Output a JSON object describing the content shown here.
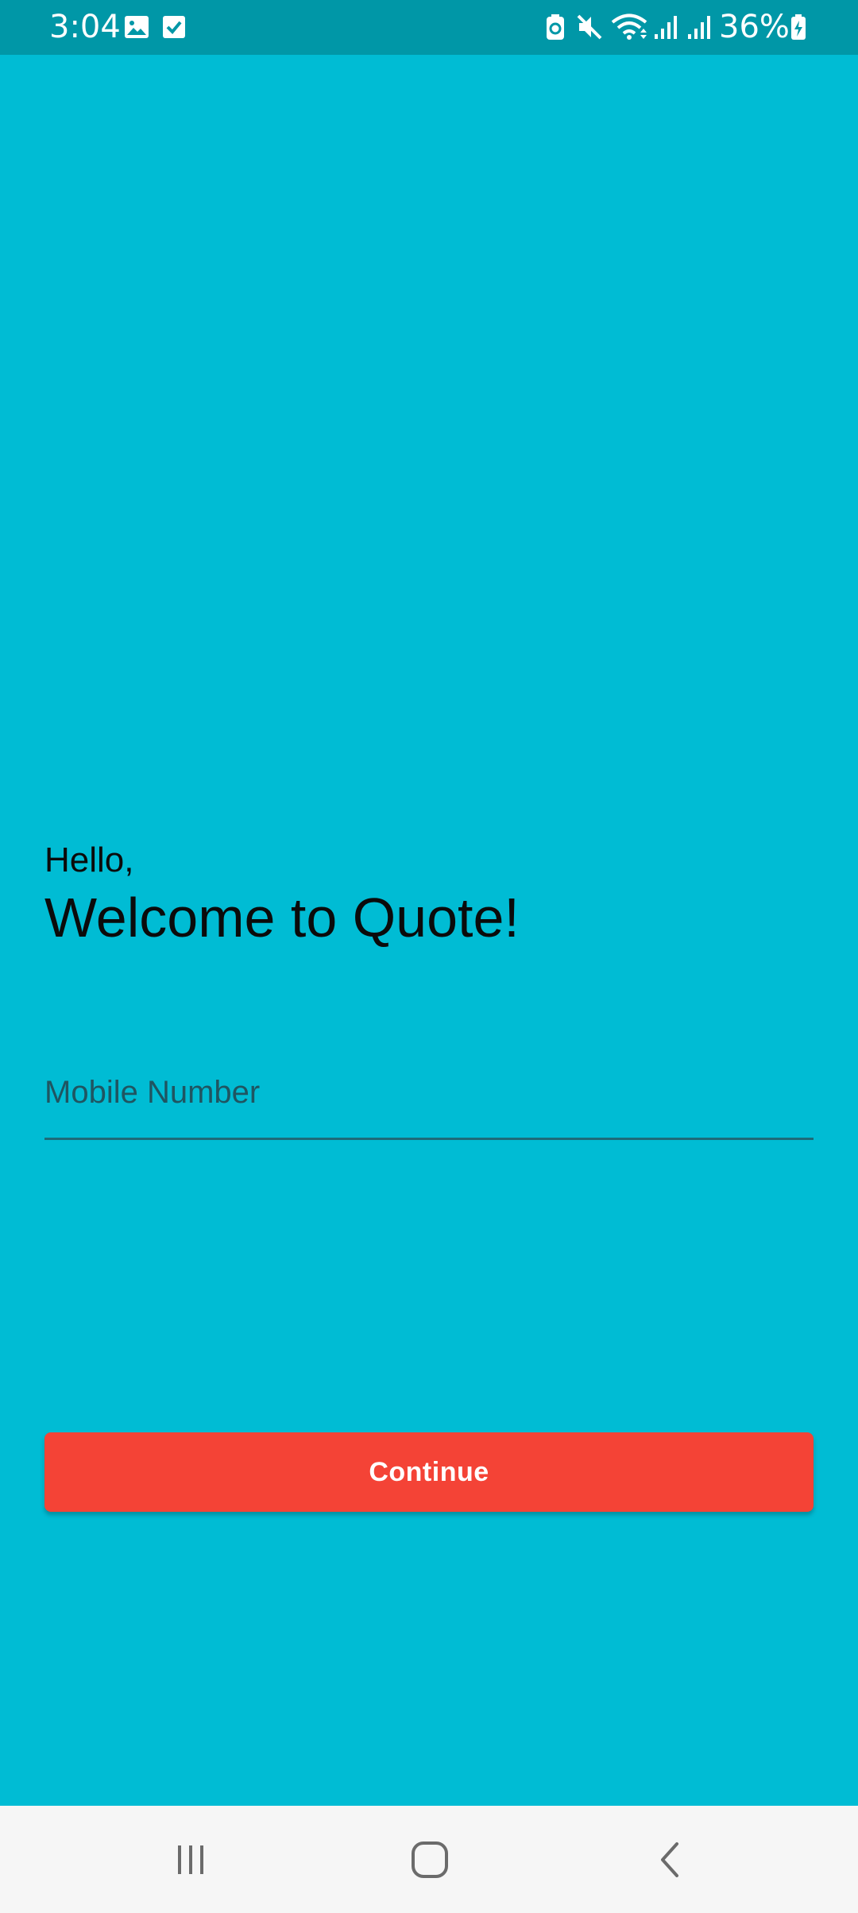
{
  "status_bar": {
    "time": "3:04",
    "battery_percent": "36%",
    "icons": [
      "gallery-icon",
      "checkbox-icon",
      "battery-saver-icon",
      "mute-icon",
      "wifi-icon",
      "signal-icon",
      "signal-icon",
      "battery-charging-icon"
    ]
  },
  "welcome": {
    "greeting": "Hello,",
    "headline": "Welcome to Quote!"
  },
  "form": {
    "mobile_placeholder": "Mobile Number",
    "mobile_value": ""
  },
  "actions": {
    "continue_label": "Continue"
  },
  "navigation": {
    "icons": [
      "recent-apps-icon",
      "home-icon",
      "back-icon"
    ]
  },
  "colors": {
    "background": "#00BCD4",
    "status_bar": "#0097A7",
    "button": "#F44336",
    "nav_bar": "#F6F6F6"
  }
}
